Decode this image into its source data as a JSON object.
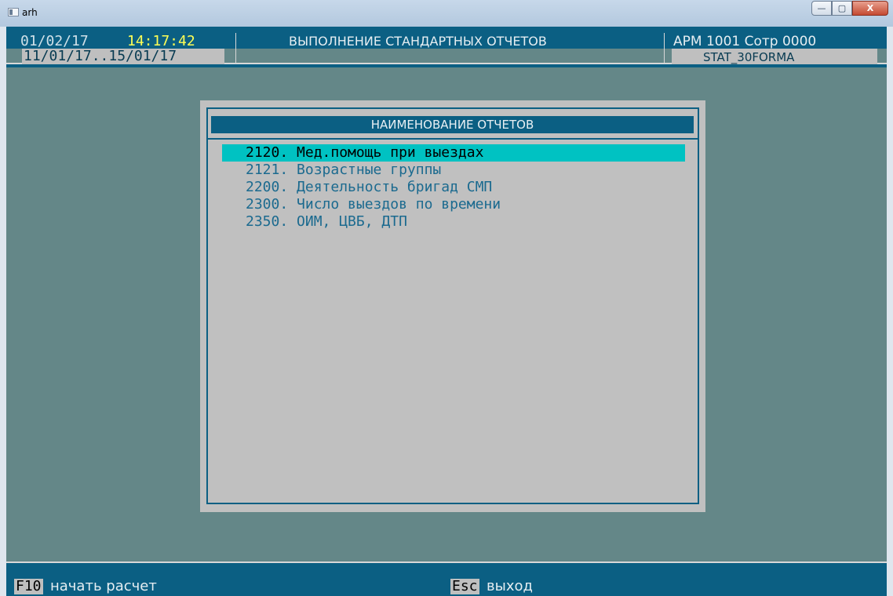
{
  "window": {
    "title": "arh",
    "controls": {
      "minimize": "—",
      "maximize": "▢",
      "close": "X"
    }
  },
  "header": {
    "date": "01/02/17",
    "time": "14:17:42",
    "title": "ВЫПОЛНЕНИЕ СТАНДАРТНЫХ ОТЧЕТОВ",
    "workstation": "АРМ 1001 Сотр 0000",
    "date_range": "11/01/17..15/01/17",
    "form_name": "STAT_30FORMA"
  },
  "dialog": {
    "title": "НАИМЕНОВАНИЕ ОТЧЕТОВ",
    "items": [
      {
        "label": "2120. Мед.помощь при выездах",
        "selected": true
      },
      {
        "label": "2121. Возрастные группы",
        "selected": false
      },
      {
        "label": "2200. Деятельность бригад СМП",
        "selected": false
      },
      {
        "label": "2300. Число выездов по времени",
        "selected": false
      },
      {
        "label": "2350. ОИМ, ЦВБ, ДТП",
        "selected": false
      }
    ]
  },
  "footer": {
    "key1": "F10",
    "key1_label": "начать расчет",
    "key2": "Esc",
    "key2_label": "выход"
  },
  "colors": {
    "background": "#648788",
    "bar": "#0b5f83",
    "highlight": "#00c2c2",
    "time": "#ffff55"
  }
}
